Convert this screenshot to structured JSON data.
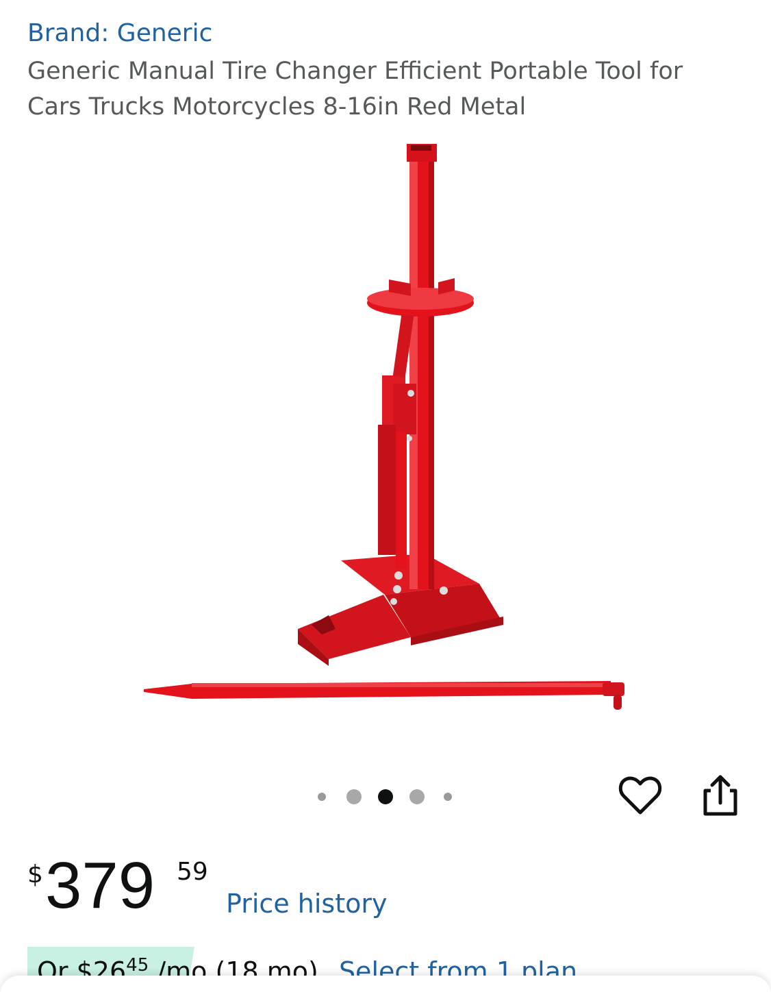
{
  "header": {
    "brand": "Brand: Generic",
    "title": "Generic Manual Tire Changer Efficient Portable Tool for Cars Trucks Motorcycles 8-16in Red Metal"
  },
  "carousel": {
    "total_dots": 5,
    "active_index": 2
  },
  "price": {
    "currency": "$",
    "whole": "379",
    "fraction": "59",
    "history_link": "Price history"
  },
  "installment": {
    "prefix": "Or $",
    "amount_whole": "26",
    "amount_fraction": "45",
    "term": "/mo (18 mo)",
    "link": "Select from 1 plan"
  },
  "icons": {
    "wishlist": "heart-icon",
    "share": "share-icon"
  },
  "colors": {
    "link": "#2162a1",
    "product_red": "#e3121b",
    "badge": "#c8f0e3"
  }
}
